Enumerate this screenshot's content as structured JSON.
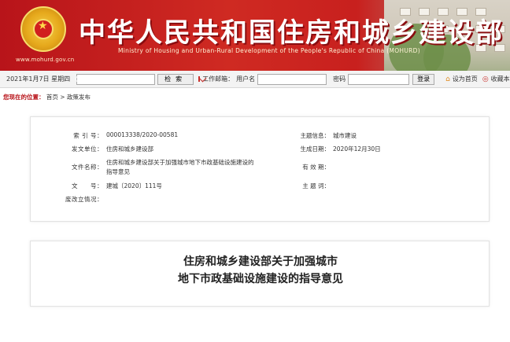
{
  "header": {
    "site_url": "www.mohurd.gov.cn",
    "title": "中华人民共和国住房和城乡建设部",
    "subtitle": "Ministry of Housing and Urban-Rural Development of the People's Republic of China (MOHURD)",
    "colors": {
      "banner_red": "#c8201e",
      "title_shadow": "#8a0d10"
    }
  },
  "toolbar": {
    "date": "2021年1月7日 星期四",
    "search_button": "检索",
    "mailbox_label": "工作邮箱：",
    "username_label": "用户名",
    "password_label": "密码",
    "login_button": "登录",
    "set_home": "设为首页",
    "add_favorite": "收藏本站"
  },
  "breadcrumb": {
    "here_label": "您现在的位置：",
    "path": "首页 > 政策发布"
  },
  "info": {
    "index_label": "索 引 号：",
    "index_value": "000013338/2020-00581",
    "publisher_label": "发文单位：",
    "publisher_value": "住房和城乡建设部",
    "doc_name_label": "文件名称：",
    "doc_name_value_1": "住房和城乡建设部关于加强城市地下市政基础设施建设的",
    "doc_name_value_2": "指导意见",
    "doc_no_label": "文　　号：",
    "doc_no_value": "建城〔2020〕111号",
    "status_label": "废改立情况：",
    "topic_label": "主题信息：",
    "topic_value": "城市建设",
    "date_label": "生成日期：",
    "date_value": "2020年12月30日",
    "validity_label": "有 效 期：",
    "keywords_label": "主 题 词："
  },
  "article": {
    "title_line1": "住房和城乡建设部关于加强城市",
    "title_line2": "地下市政基础设施建设的指导意见"
  }
}
